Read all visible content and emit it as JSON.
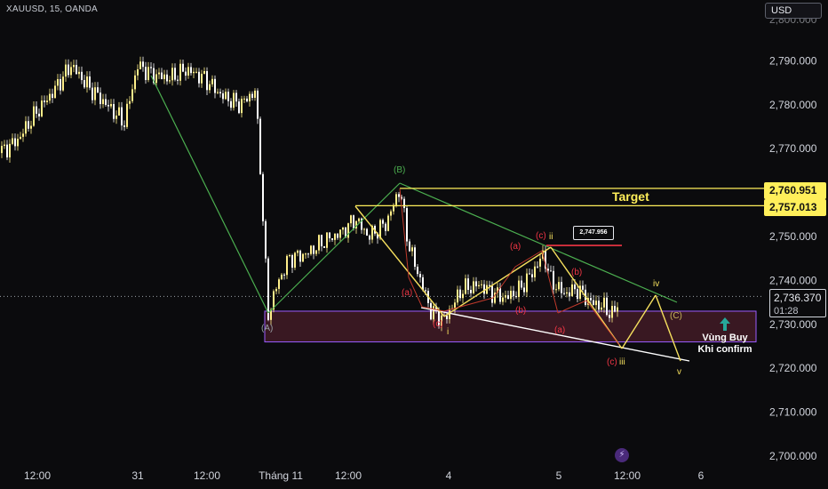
{
  "header": {
    "symbol": "XAUUSD, 15, OANDA",
    "currency_button": "USD"
  },
  "price_scale": {
    "ticks": [
      "2,790.000",
      "2,780.000",
      "2,770.000",
      "2,760.000",
      "2,750.000",
      "2,740.000",
      "2,730.000",
      "2,720.000",
      "2,710.000",
      "2,700.000"
    ],
    "tick_values": [
      2790,
      2780,
      2770,
      2760,
      2750,
      2740,
      2730,
      2720,
      2710,
      2700
    ],
    "target1": "2,760.951",
    "target2": "2,757.013",
    "current_price": "2,736.370",
    "countdown": "01:28"
  },
  "time_axis": {
    "labels": [
      "12:00",
      "31",
      "12:00",
      "Tháng 11",
      "12:00",
      "4",
      "5",
      "12:00",
      "6"
    ]
  },
  "annotations": {
    "target": "Target",
    "buy_zone_line1": "Vùng Buy",
    "buy_zone_line2": "Khi confirm",
    "price_tag": "2,747.956",
    "wave_A": "(A)",
    "wave_B": "(B)",
    "wave_C": "(C)",
    "red_a1": "(a)",
    "red_c1": "(c)",
    "red_a2": "(a)",
    "red_b2": "(b)",
    "red_c2": "(c)",
    "red_a3": "(a)",
    "red_b3": "(b)",
    "red_c3": "(c)",
    "i": "i",
    "ii": "ii",
    "iii": "iii",
    "iv": "iv",
    "v": "v"
  },
  "colors": {
    "background": "#0b0b0d",
    "bull": "#ffef8a",
    "bear": "#ffffff",
    "target": "#ffef5a",
    "zone": "#4a1e2a",
    "zone_border": "#9b5cff",
    "green_line": "#4caf50",
    "red": "#f23645",
    "yellow_path": "#f6e05e"
  },
  "chart_data": {
    "type": "candlestick",
    "title": "",
    "ylabel": "",
    "ylim": [
      2697,
      2799
    ],
    "levels": [
      2760.951,
      2757.013,
      2747.956,
      2736.37
    ],
    "buy_zone": [
      2726,
      2733
    ],
    "close_path": [
      [
        0,
        2769
      ],
      [
        20,
        2772
      ],
      [
        40,
        2778
      ],
      [
        60,
        2783
      ],
      [
        80,
        2789
      ],
      [
        100,
        2784
      ],
      [
        120,
        2780
      ],
      [
        140,
        2776
      ],
      [
        155,
        2789
      ],
      [
        170,
        2787
      ],
      [
        190,
        2786
      ],
      [
        210,
        2788
      ],
      [
        230,
        2786
      ],
      [
        250,
        2782
      ],
      [
        270,
        2780
      ],
      [
        287,
        2783
      ],
      [
        292,
        2770
      ],
      [
        297,
        2750
      ],
      [
        302,
        2732
      ],
      [
        310,
        2738
      ],
      [
        325,
        2745
      ],
      [
        345,
        2746
      ],
      [
        365,
        2749
      ],
      [
        385,
        2751
      ],
      [
        400,
        2754
      ],
      [
        415,
        2750
      ],
      [
        435,
        2753
      ],
      [
        450,
        2761
      ],
      [
        460,
        2748
      ],
      [
        470,
        2742
      ],
      [
        485,
        2733
      ],
      [
        500,
        2731
      ],
      [
        520,
        2738
      ],
      [
        540,
        2739
      ],
      [
        555,
        2737
      ],
      [
        570,
        2736
      ],
      [
        585,
        2738
      ],
      [
        600,
        2742
      ],
      [
        612,
        2746
      ],
      [
        620,
        2740
      ],
      [
        635,
        2737
      ],
      [
        650,
        2738
      ],
      [
        665,
        2735
      ],
      [
        680,
        2734
      ],
      [
        690,
        2732
      ],
      [
        697,
        2736
      ]
    ]
  }
}
